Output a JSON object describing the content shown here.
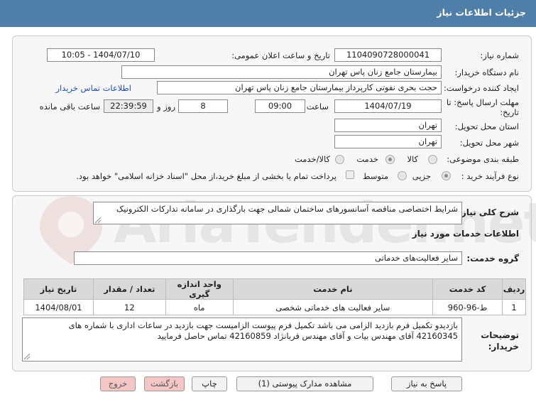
{
  "header": {
    "title": "جزئیات اطلاعات نیاز"
  },
  "form": {
    "need_number_label": "شماره نیاز:",
    "need_number": "1104090728000041",
    "announce_label": "تاریخ و ساعت اعلان عمومی:",
    "announce_value": "1404/07/10 - 10:05",
    "buyer_org_label": "نام دستگاه خریدار:",
    "buyer_org": "بیمارستان جامع زنان پاس تهران",
    "creator_label": "ایجاد کننده درخواست:",
    "creator": "حجت بحری نفوتی کارپرداز بیمارستان جامع زنان پاس تهران",
    "contact_link": "اطلاعات تماس خریدار",
    "deadline_label_1": "مهلت ارسال پاسخ: تا",
    "deadline_label_2": "تاریخ:",
    "deadline_date": "1404/07/19",
    "hour_label": "ساعت",
    "deadline_time": "09:00",
    "days_value": "8",
    "days_label": "روز و",
    "remaining_time": "22:39:59",
    "remaining_label": "ساعت باقی مانده",
    "province_label": "استان محل تحویل:",
    "province": "تهران",
    "city_label": "شهر محل تحویل:",
    "city": "تهران",
    "category_label": "طبقه بندی موضوعی:",
    "category_options": [
      "کالا",
      "خدمت",
      "کالا/خدمت"
    ],
    "category_selected": "خدمت",
    "process_label": "نوع فرآیند خرید :",
    "process_options": [
      "جزیی",
      "متوسط"
    ],
    "process_selected": "جزیی",
    "payment_note": "پرداخت تمام یا بخشی از مبلغ خرید،از محل \"اسناد خزانه اسلامی\" خواهد بود."
  },
  "details": {
    "general_desc_label": "شرح کلی نیاز:",
    "general_desc": "شرایط اختصاصی مناقصه آسانسورهای ساختمان شمالی جهت بارگذاری در سامانه تدارکات الکترونیک",
    "services_info_title": "اطلاعات خدمات مورد نیاز",
    "service_group_label": "گروه خدمت:",
    "service_group": "سایر فعالیت‌های خدماتی",
    "table": {
      "headers": [
        "ردیف",
        "کد خدمت",
        "نام خدمت",
        "واحد اندازه گیری",
        "تعداد / مقدار",
        "تاریخ نیاز"
      ],
      "rows": [
        [
          "1",
          "ط-96-960",
          "سایر فعالیت های خدماتی شخصی",
          "ماه",
          "12",
          "1404/08/01"
        ]
      ]
    },
    "buyer_notes_label_1": "توضیحات",
    "buyer_notes_label_2": "خریدار:",
    "buyer_notes_line1": "بازدیدو تکمیل فرم بازدید الزامی می باشد  تکمیل فرم پیوست الزامیست  جهت بازدید در ساعات اداری با شماره های",
    "buyer_notes_line2": "42160345  آقای مهندس بیات و آقای مهندس قربانژاد 42160859 تماس حاصل فرمایید"
  },
  "buttons": {
    "reply": "پاسخ به نیاز",
    "attachments": "مشاهده مدارک پیوستی (1)",
    "print": "چاپ",
    "back": "بازگشت",
    "exit": "خروج"
  },
  "watermark": {
    "text": "AriaTender.net"
  },
  "colors": {
    "header_bg": "#4f7fa8",
    "link": "#1f4fb5",
    "pink_button": "#f5c6c6"
  }
}
